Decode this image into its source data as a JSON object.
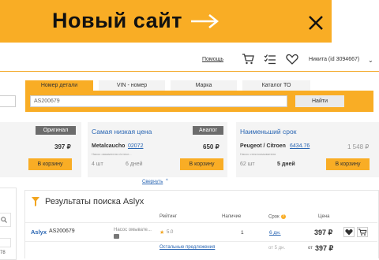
{
  "promo": {
    "title": "Новый сайт",
    "arrow_icon": "arrow-right-icon",
    "close_icon": "close-icon",
    "color": "#f9ad25"
  },
  "header": {
    "help": "Помощь",
    "cart_icon": "cart-icon",
    "list_icon": "list-icon",
    "heart_icon": "heart-icon",
    "user": "Никита (id 3094667)",
    "chevron": "⌄"
  },
  "search": {
    "tabs": [
      "Номер детали",
      "VIN - номер",
      "Марка",
      "Каталог ТО"
    ],
    "active_tab": "Номер детали",
    "value": "AS200679",
    "button": "Найти"
  },
  "offers": [
    {
      "title": "",
      "badge": "Оригинал",
      "brand": "",
      "code": "",
      "desc": "",
      "price": "397 ₽",
      "stock": "",
      "days": "",
      "cart": "В корзину"
    },
    {
      "title": "Самая низкая цена",
      "badge": "Аналог",
      "brand": "Metalcaucho",
      "code": "02072",
      "desc": "Насос омывателя c/стекл...",
      "price": "650 ₽",
      "stock": "4 шт",
      "days": "6 дней",
      "cart": "В корзину"
    },
    {
      "title": "Наименьший срок",
      "badge": "",
      "brand": "Peugeot / Citroen",
      "code": "6434.76",
      "desc": "Насос стеклоомывателя",
      "price": "1 548 ₽",
      "stock": "62 шт",
      "days": "5 дней",
      "cart": "В корзину"
    }
  ],
  "collapse": {
    "label": "Свернуть",
    "chevron": "^"
  },
  "left_panel": {
    "search_icon": "search-icon",
    "number": "78"
  },
  "results": {
    "title": "Результаты поиска Aslyx",
    "funnel_icon": "funnel-icon",
    "columns": [
      "Рейтинг",
      "Наличие",
      "Срок",
      "Цена"
    ],
    "help_mark": "?",
    "row": {
      "brand": "Aslyx",
      "code": "AS200679",
      "desc": "Насос омывате...",
      "camera_icon": "camera-icon",
      "star": "★",
      "rating": "5.0",
      "stock": "1",
      "days": "6 дн.",
      "price": "397 ₽",
      "heart_icon": "heart-icon",
      "cart_icon": "cart-icon"
    },
    "row2": {
      "link": "Остальные предложения",
      "days": "от 5 дн.",
      "from": "от",
      "price": "397 ₽"
    }
  }
}
